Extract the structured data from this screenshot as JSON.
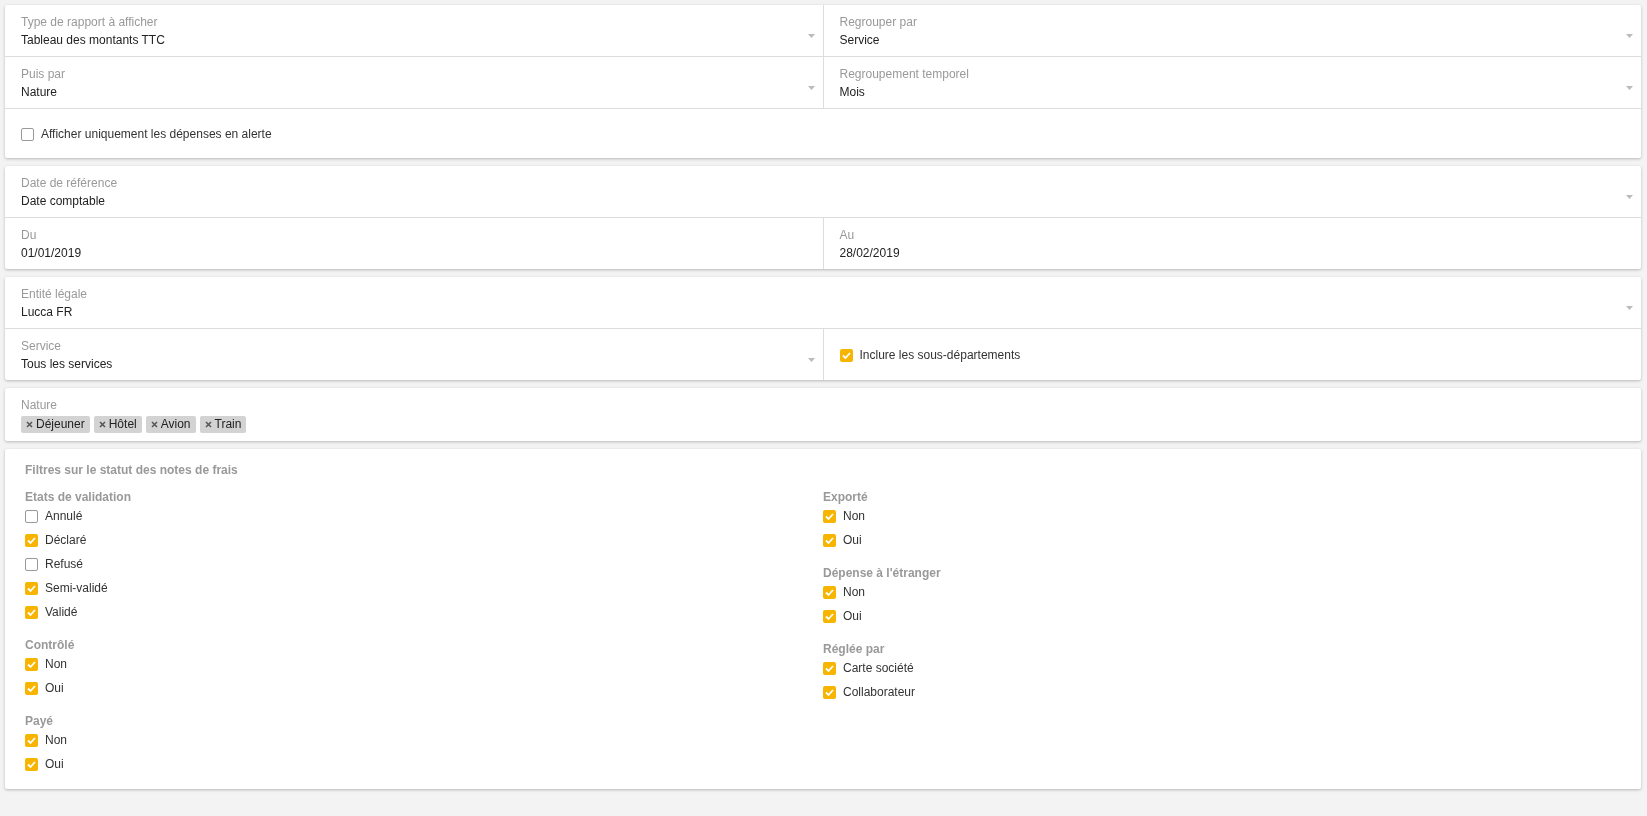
{
  "report": {
    "rows": [
      [
        {
          "kind": "select",
          "label": "Type de rapport à afficher",
          "value": "Tableau des montants TTC"
        },
        {
          "kind": "select",
          "label": "Regrouper par",
          "value": "Service"
        }
      ],
      [
        {
          "kind": "select",
          "label": "Puis par",
          "value": "Nature"
        },
        {
          "kind": "select",
          "label": "Regroupement temporel",
          "value": "Mois"
        }
      ],
      [
        {
          "kind": "checkbox",
          "label": "Afficher uniquement les dépenses en alerte",
          "checked": false
        }
      ]
    ]
  },
  "period": {
    "rows": [
      [
        {
          "kind": "select",
          "label": "Date de référence",
          "value": "Date comptable"
        }
      ],
      [
        {
          "kind": "date",
          "label": "Du",
          "value": "01/01/2019"
        },
        {
          "kind": "date",
          "label": "Au",
          "value": "28/02/2019"
        }
      ]
    ]
  },
  "organisation": {
    "rows": [
      [
        {
          "kind": "select",
          "label": "Entité légale",
          "value": "Lucca FR"
        }
      ],
      [
        {
          "kind": "select",
          "label": "Service",
          "value": "Tous les services"
        },
        {
          "kind": "checkbox",
          "label": "Inclure les sous-départements",
          "checked": true
        }
      ]
    ]
  },
  "nature": {
    "label": "Nature",
    "tags": [
      {
        "label": "Déjeuner"
      },
      {
        "label": "Hôtel"
      },
      {
        "label": "Avion"
      },
      {
        "label": "Train"
      }
    ]
  },
  "status_filters": {
    "title": "Filtres sur le statut des notes de frais",
    "columns": [
      [
        {
          "label": "Etats de validation",
          "options": [
            {
              "label": "Annulé",
              "checked": false
            },
            {
              "label": "Déclaré",
              "checked": true
            },
            {
              "label": "Refusé",
              "checked": false
            },
            {
              "label": "Semi-validé",
              "checked": true
            },
            {
              "label": "Validé",
              "checked": true
            }
          ]
        },
        {
          "label": "Contrôlé",
          "options": [
            {
              "label": "Non",
              "checked": true
            },
            {
              "label": "Oui",
              "checked": true
            }
          ]
        },
        {
          "label": "Payé",
          "options": [
            {
              "label": "Non",
              "checked": true
            },
            {
              "label": "Oui",
              "checked": true
            }
          ]
        }
      ],
      [
        {
          "label": "Exporté",
          "options": [
            {
              "label": "Non",
              "checked": true
            },
            {
              "label": "Oui",
              "checked": true
            }
          ]
        },
        {
          "label": "Dépense à l'étranger",
          "options": [
            {
              "label": "Non",
              "checked": true
            },
            {
              "label": "Oui",
              "checked": true
            }
          ]
        },
        {
          "label": "Réglée par",
          "options": [
            {
              "label": "Carte société",
              "checked": true
            },
            {
              "label": "Collaborateur",
              "checked": true
            }
          ]
        }
      ]
    ]
  }
}
